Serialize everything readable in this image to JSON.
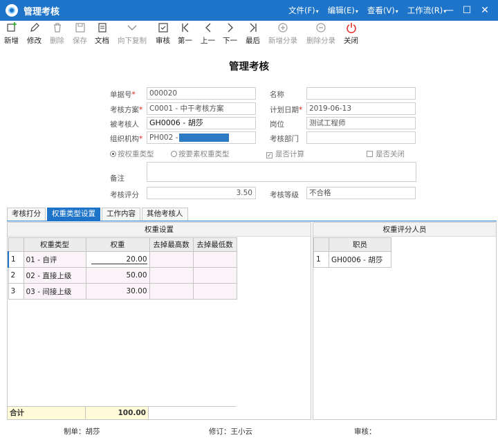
{
  "window": {
    "title": "管理考核"
  },
  "menu": [
    {
      "label": "文件(F)"
    },
    {
      "label": "编辑(E)"
    },
    {
      "label": "查看(V)"
    },
    {
      "label": "工作流(R)"
    }
  ],
  "toolbar": {
    "new": "新增",
    "edit": "修改",
    "delete": "删除",
    "save": "保存",
    "doc": "文档",
    "copy_down": "向下复制",
    "audit": "审核",
    "first": "第一",
    "prev": "上一",
    "next": "下一",
    "last": "最后",
    "add_entry": "新增分录",
    "delete_entry": "删除分录",
    "close": "关闭"
  },
  "page_title": "管理考核",
  "form": {
    "doc_no_label": "单据号",
    "doc_no": "000020",
    "name_label": "名称",
    "name": "",
    "plan_label": "考核方案",
    "plan": "C0001 - 中干考核方案",
    "plan_date_label": "计划日期",
    "plan_date": "2019-06-13",
    "examinee_label": "被考核人",
    "examinee": "GH0006 - 胡莎",
    "position_label": "岗位",
    "position": "测试工程师",
    "org_label": "组织机构",
    "org": "PH002 -",
    "dept_label": "考核部门",
    "dept": "",
    "radio_weight_type": "按权重类型",
    "radio_element_type": "按要素权重类型",
    "check_calc": "是否计算",
    "check_close": "是否关闭",
    "remark_label": "备注",
    "remark": "",
    "score_label": "考核评分",
    "score": "3.50",
    "grade_label": "考核等级",
    "grade": "不合格"
  },
  "tabs": [
    {
      "label": "考核打分"
    },
    {
      "label": "权重类型设置"
    },
    {
      "label": "工作内容"
    },
    {
      "label": "其他考核人"
    }
  ],
  "weight_panel": {
    "title": "权重设置",
    "columns": [
      "权重类型",
      "权重",
      "去掉最高数",
      "去掉最低数"
    ],
    "rows": [
      {
        "n": "1",
        "type": "01 - 自评",
        "weight": "20.00",
        "drop_high": "",
        "drop_low": ""
      },
      {
        "n": "2",
        "type": "02 - 直接上级",
        "weight": "50.00",
        "drop_high": "",
        "drop_low": ""
      },
      {
        "n": "3",
        "type": "03 - 间接上级",
        "weight": "30.00",
        "drop_high": "",
        "drop_low": ""
      }
    ],
    "total_label": "合计",
    "total": "100.00"
  },
  "rater_panel": {
    "title": "权重评分人员",
    "columns": [
      "职员"
    ],
    "rows": [
      {
        "n": "1",
        "staff": "GH0006 - 胡莎"
      }
    ]
  },
  "status": {
    "maker": "制单：胡莎",
    "revisor": "修订：王小云",
    "auditor": "审核："
  },
  "colors": {
    "accent": "#1e74c9",
    "required": "#e2231a",
    "close_icon": "#e2231a"
  }
}
